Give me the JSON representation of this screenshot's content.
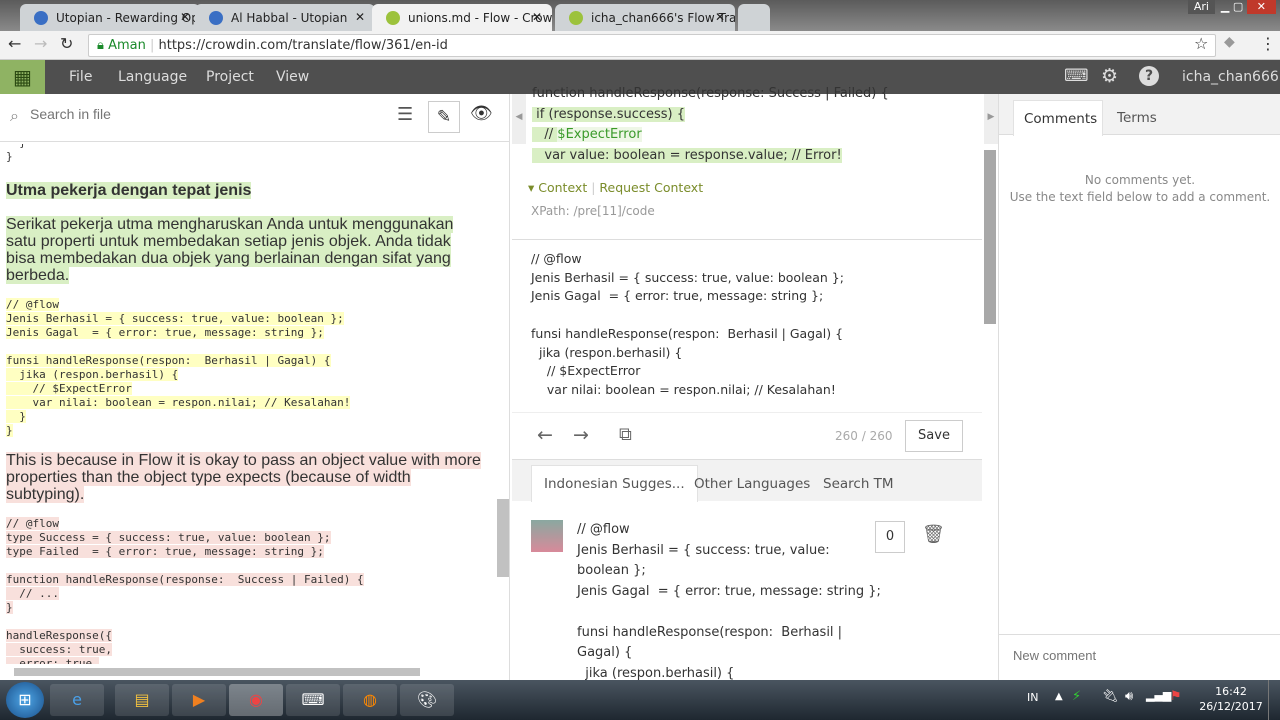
{
  "browser": {
    "tabs": [
      {
        "title": "Utopian - Rewarding Op"
      },
      {
        "title": "Al Habbal - Utopian"
      },
      {
        "title": "unions.md - Flow - Crow"
      },
      {
        "title": "icha_chan666's Flow Tran"
      }
    ],
    "window_user": "Ari",
    "secure_label": "Aman",
    "url": "https://crowdin.com/translate/flow/361/en-id"
  },
  "menu": {
    "items": [
      "File",
      "Language",
      "Project",
      "View"
    ],
    "username": "icha_chan666"
  },
  "left": {
    "search_placeholder": "Search in file",
    "top_lines": "  }\n}",
    "heading": "Utma pekerja dengan tepat jenis",
    "para1": "Serikat pekerja utma mengharuskan Anda untuk menggunakan satu properti untuk membedakan setiap jenis objek. Anda tidak bisa membedakan dua objek yang berlainan dengan sifat yang berbeda.",
    "code1": "// @flow\nJenis Berhasil = { success: true, value: boolean };\nJenis Gagal  = { error: true, message: string };",
    "code2": "funsi handleResponse(respon:  Berhasil | Gagal) {\n  jika (respon.berhasil) {\n    // $ExpectError\n    var nilai: boolean = respon.nilai; // Kesalahan!\n  }\n}",
    "para2": "This is because in Flow it is okay to pass an object value with more properties than the object type expects (because of width subtyping).",
    "code3": "// @flow\ntype Success = { success: true, value: boolean };\ntype Failed  = { error: true, message: string };",
    "code4": "function handleResponse(response:  Success | Failed) {\n  // ...\n}",
    "code5": "handleResponse({\n  success: true,\n  error: true,\n  value: true,\n  message: 'hi'"
  },
  "source": {
    "lines": [
      "function handleResponse(response:  Success | Failed) {",
      " if (response.success) {",
      "   // ",
      "   var value: boolean = response.value; // Error!"
    ],
    "expect_error": "$ExpectError",
    "context_label": "Context",
    "request_context": "Request Context",
    "xpath": "XPath: /pre[11]/code"
  },
  "translation": {
    "text": "// @flow\nJenis Berhasil = { success: true, value: boolean };\nJenis Gagal  = { error: true, message: string };\n\nfunsi handleResponse(respon:  Berhasil | Gagal) {\n  jika (respon.berhasil) {\n    // $ExpectError\n    var nilai: boolean = respon.nilai; // Kesalahan!",
    "counter": "260 / 260",
    "save": "Save"
  },
  "suggest_tabs": [
    "Indonesian Sugges...",
    "Other Languages",
    "Search TM"
  ],
  "suggestion": {
    "text": "// @flow\nJenis Berhasil = { success: true, value:\nboolean };\nJenis Gagal  = { error: true, message: string };\n\nfunsi handleResponse(respon:  Berhasil |\nGagal) {\n  jika (respon.berhasil) {",
    "votes": "0"
  },
  "right": {
    "tabs": [
      "Comments",
      "Terms"
    ],
    "empty1": "No comments yet.",
    "empty2": "Use the text field below to add a comment.",
    "new_comment_placeholder": "New comment"
  },
  "taskbar": {
    "lang": "IN",
    "time": "16:42",
    "date": "26/12/2017"
  }
}
